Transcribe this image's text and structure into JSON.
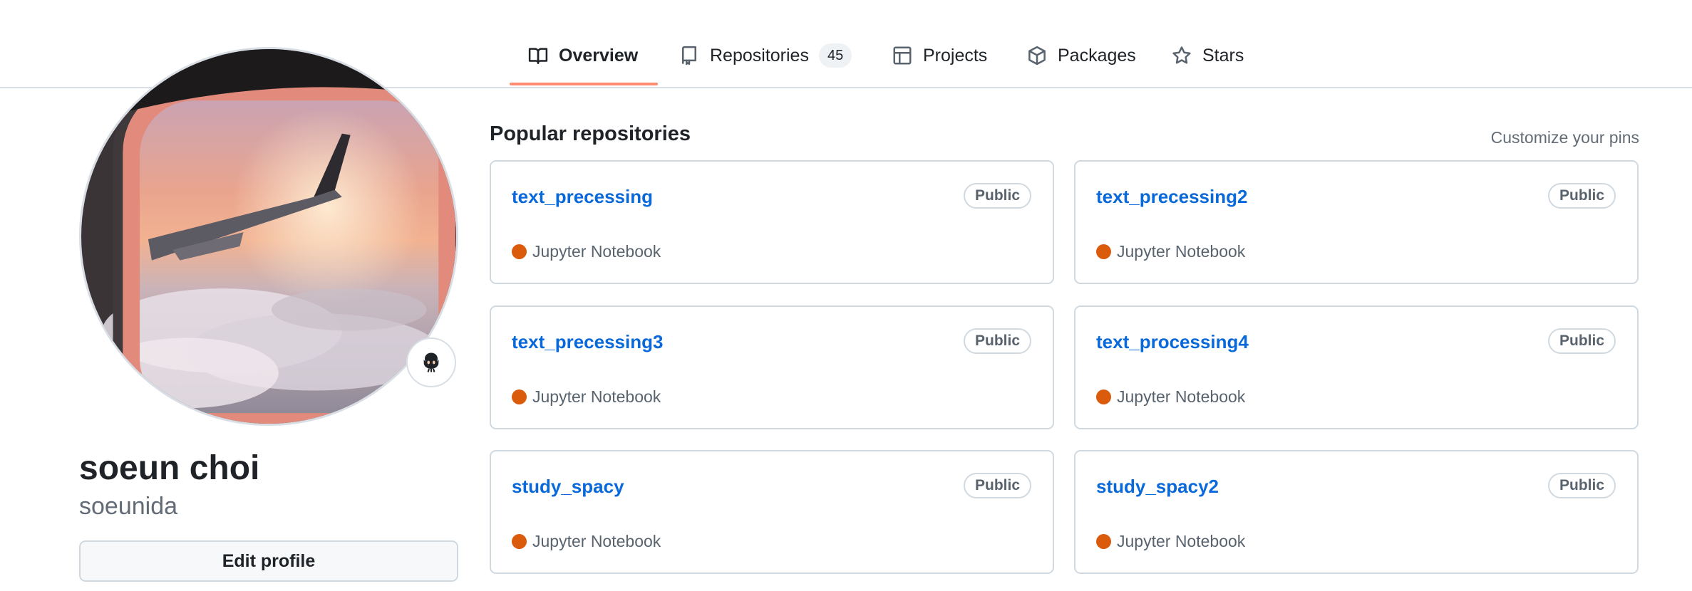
{
  "nav": {
    "tabs": [
      {
        "label": "Overview",
        "icon": "book-icon",
        "active": true
      },
      {
        "label": "Repositories",
        "icon": "repo-icon",
        "count": "45"
      },
      {
        "label": "Projects",
        "icon": "table-icon"
      },
      {
        "label": "Packages",
        "icon": "package-icon"
      },
      {
        "label": "Stars",
        "icon": "star-icon"
      }
    ]
  },
  "profile": {
    "avatar_alt": "airplane window sunset photo",
    "status_icon": "octocat-icon",
    "full_name": "soeun choi",
    "username": "soeunida",
    "edit_label": "Edit profile"
  },
  "repos": {
    "title": "Popular repositories",
    "customize_label": "Customize your pins",
    "items": [
      {
        "name": "text_precessing",
        "visibility": "Public",
        "language": "Jupyter Notebook",
        "lang_color": "#DA5B0B"
      },
      {
        "name": "text_precessing2",
        "visibility": "Public",
        "language": "Jupyter Notebook",
        "lang_color": "#DA5B0B"
      },
      {
        "name": "text_precessing3",
        "visibility": "Public",
        "language": "Jupyter Notebook",
        "lang_color": "#DA5B0B"
      },
      {
        "name": "text_processing4",
        "visibility": "Public",
        "language": "Jupyter Notebook",
        "lang_color": "#DA5B0B"
      },
      {
        "name": "study_spacy",
        "visibility": "Public",
        "language": "Jupyter Notebook",
        "lang_color": "#DA5B0B"
      },
      {
        "name": "study_spacy2",
        "visibility": "Public",
        "language": "Jupyter Notebook",
        "lang_color": "#DA5B0B"
      }
    ]
  },
  "colors": {
    "link": "#0969da",
    "tab_underline": "#fd8c73",
    "jupyter": "#DA5B0B"
  }
}
